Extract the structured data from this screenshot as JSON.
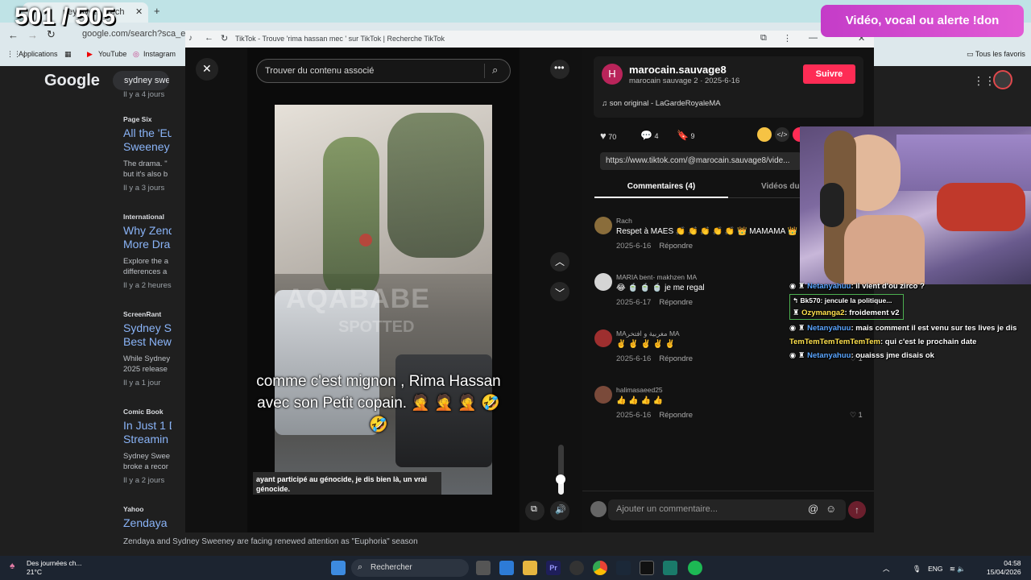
{
  "stream_overlay": {
    "counter": "501 / 505",
    "donate_banner": "Vidéo, vocal ou alerte !don",
    "chat": [
      {
        "user": "Netanyahuu",
        "message": ": il vient d'ou zirco ?"
      },
      {
        "reply_to": "Bk570: jencule la politique...",
        "user": "Ozymanga2",
        "message": ": froidement v2"
      },
      {
        "user": "Netanyahuu",
        "message": ": mais comment il est venu sur tes lives je dis"
      },
      {
        "user": "TemTemTemTemTemTem",
        "message": ": qui c'est le prochain date"
      },
      {
        "user": "Netanyahuu",
        "message": ": ouaisss jme disais ok"
      }
    ]
  },
  "bg_browser": {
    "tab_label": "ney ave... Rech",
    "address": "google.com/search?sca_esv=",
    "bookmarks": [
      "Applications",
      "YouTube",
      "Instagram"
    ],
    "bookmarks_right": "Tous les favoris"
  },
  "google": {
    "logo": "Google",
    "query": "sydney swee",
    "results": [
      {
        "source": "",
        "title": "",
        "snippet": "",
        "time": "Il y a 4 jours"
      },
      {
        "source": "Page Six",
        "title": "All the 'Eu",
        "title2": "Sweeney",
        "snippet": "The drama. \"",
        "snippet2": "but it's also b",
        "time": "Il y a 3 jours"
      },
      {
        "source": "International",
        "title": "Why Zend",
        "title2": "More Dra",
        "snippet": "Explore the a",
        "snippet2": "differences a",
        "time": "Il y a 2 heures"
      },
      {
        "source": "ScreenRant",
        "title": "Sydney S",
        "title2": "Best New",
        "snippet": "While Sydney",
        "snippet2": "2025 release",
        "time": "Il y a 1 jour"
      },
      {
        "source": "Comic Book",
        "title": "In Just 1 D",
        "title2": "Streamin",
        "snippet": "Sydney Swee",
        "snippet2": "broke a recor",
        "time": "Il y a 2 jours"
      },
      {
        "source": "Yahoo",
        "title": "Zendaya",
        "title2": "",
        "snippet": "",
        "snippet2": "",
        "time": ""
      }
    ],
    "bottom_snippet": "Zendaya and Sydney Sweeney are facing renewed attention as \"Euphoria\" season"
  },
  "tiktok": {
    "window_title": "TikTok - Trouve 'rima hassan mec ' sur TikTok | Recherche TikTok",
    "search_placeholder": "Trouver du contenu associé",
    "video": {
      "watermark": "AQABABE",
      "watermark2": "SPOTTED",
      "caption": "comme c'est mignon , Rima Hassan avec son Petit copain. 🤦 🤦 🤦 🤣 🤣",
      "subtitle": "ayant participé au génocide, je dis bien là, un vrai génocide.",
      "volume_level": 0.3
    },
    "author": {
      "avatar_letter": "H",
      "username": "marocain.sauvage8",
      "subline": "marocain sauvage 2 · 2025-6-16",
      "follow_label": "Suivre",
      "sound": "son original - LaGardeRoyaleMA"
    },
    "stats": {
      "likes": "70",
      "comments": "4",
      "saves": "9"
    },
    "link": "https://www.tiktok.com/@marocain.sauvage8/vide...",
    "tabs": {
      "comments": "Commentaires (4)",
      "videos": "Vidéos du cr"
    },
    "comments": [
      {
        "user": "Rach",
        "text": "Respet à MAES 👏 👏 👏 👏 👏 👑 MAMAMA 👑 😂",
        "date": "2025-6-16",
        "reply": "Répondre",
        "likes": "",
        "avatar_color": "#8a6d3b"
      },
      {
        "user": "MARIA bent- makhzen MA",
        "text": "😂 🍵 🍵 🍵 je me regal",
        "date": "2025-6-17",
        "reply": "Répondre",
        "likes": "",
        "avatar_color": "#d5d5d5"
      },
      {
        "user": "MAمغربية و افتخر MA",
        "text": "✌️ ✌️ ✌️ ✌️ ✌️",
        "date": "2025-6-16",
        "reply": "Répondre",
        "likes": "1",
        "avatar_color": "#9e2f2f"
      },
      {
        "user": "halimasaeed25",
        "text": "👍 👍 👍 👍",
        "date": "2025-6-16",
        "reply": "Répondre",
        "likes": "1",
        "avatar_color": "#7a4a3a"
      }
    ],
    "comment_placeholder": "Ajouter un commentaire..."
  },
  "taskbar": {
    "weather_title": "Des journées ch...",
    "weather_temp": "21°C",
    "search_label": "Rechercher",
    "lang": "ENG",
    "time": "04:58",
    "date": "15/04/2026"
  },
  "colors": {
    "tiktok_red": "#fe2c55",
    "donate_pink": "#d54bd1",
    "link_blue": "#8ab4f8"
  }
}
